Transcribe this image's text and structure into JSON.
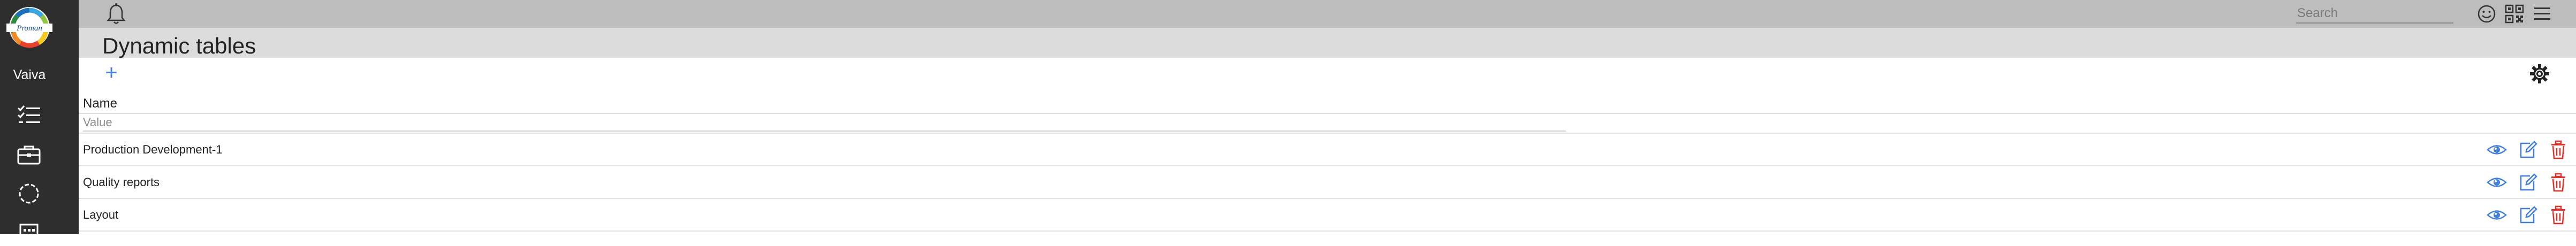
{
  "sidebar": {
    "logo_text": "Proman",
    "user_label": "Vaiva",
    "icons": [
      "tasks-icon",
      "briefcase-icon",
      "loader-circle-icon",
      "calendar-icon"
    ]
  },
  "topbar": {
    "search_placeholder": "Search",
    "icons": [
      "bell-icon",
      "smiley-icon",
      "qr-code-icon",
      "menu-icon"
    ]
  },
  "page": {
    "title": "Dynamic tables",
    "add_label": "+"
  },
  "table": {
    "column_header": "Name",
    "filter_placeholder": "Value",
    "rows": [
      {
        "name": "Production Development-1"
      },
      {
        "name": "Quality reports"
      },
      {
        "name": "Layout"
      }
    ]
  },
  "colors": {
    "sidebar_bg": "#2e2e2e",
    "topbar_bg": "#bdbdbd",
    "title_band_bg": "#dcdcdc",
    "action_blue": "#3f7fd9",
    "delete_red": "#e0302b"
  }
}
